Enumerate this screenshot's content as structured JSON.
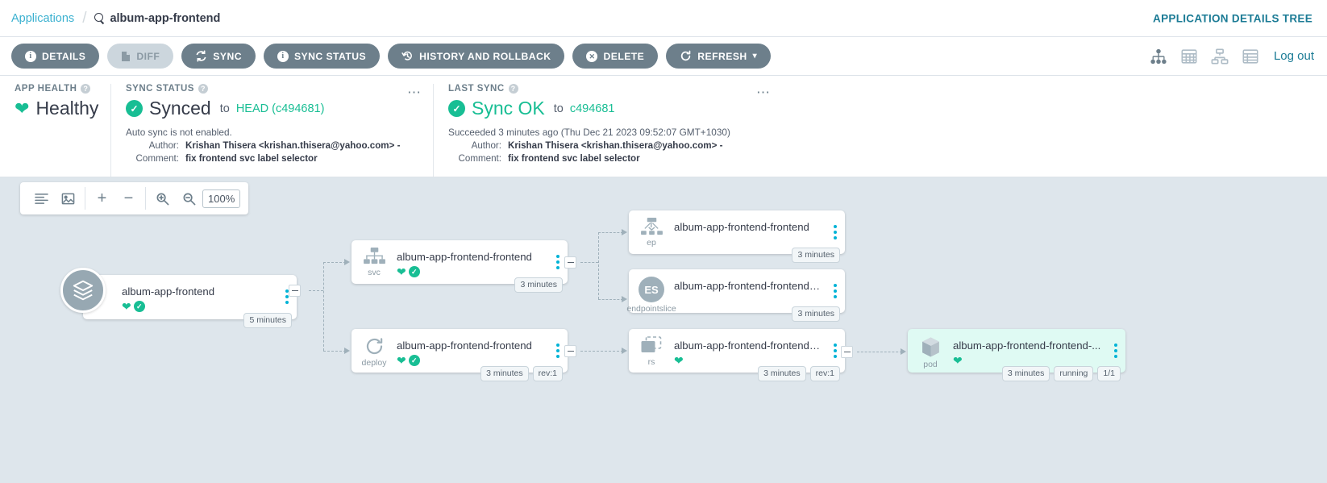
{
  "breadcrumb": {
    "root_label": "Applications",
    "separator": "/",
    "current_label": "album-app-frontend",
    "search_icon": "search-icon"
  },
  "header": {
    "details_tree_label": "APPLICATION DETAILS TREE",
    "logout_label": "Log out"
  },
  "toolbar": {
    "buttons": [
      {
        "label": "DETAILS",
        "icon": "info-icon",
        "disabled": false
      },
      {
        "label": "DIFF",
        "icon": "file-icon",
        "disabled": true
      },
      {
        "label": "SYNC",
        "icon": "sync-icon",
        "disabled": false
      },
      {
        "label": "SYNC STATUS",
        "icon": "info-icon",
        "disabled": false
      },
      {
        "label": "HISTORY AND ROLLBACK",
        "icon": "history-icon",
        "disabled": false
      },
      {
        "label": "DELETE",
        "icon": "delete-icon",
        "disabled": false
      },
      {
        "label": "REFRESH",
        "icon": "refresh-icon",
        "disabled": false,
        "caret": "▾"
      }
    ],
    "view_icons": [
      "tree-view-icon",
      "grid-view-icon",
      "network-view-icon",
      "list-view-icon"
    ]
  },
  "panels": {
    "health": {
      "title": "APP HEALTH",
      "help_icon": "help-icon",
      "status": "Healthy",
      "icon": "heart-icon"
    },
    "sync": {
      "title": "SYNC STATUS",
      "help_icon": "help-icon",
      "status": "Synced",
      "to_word": "to",
      "revision": "HEAD (c494681)",
      "note": "Auto sync is not enabled.",
      "author_key": "Author:",
      "author_value": "Krishan Thisera <krishan.thisera@yahoo.com> -",
      "comment_key": "Comment:",
      "comment_value": "fix frontend svc label selector",
      "overflow_icon": "more-options-icon"
    },
    "last_sync": {
      "title": "LAST SYNC",
      "help_icon": "help-icon",
      "status": "Sync OK",
      "to_word": "to",
      "revision": "c494681",
      "note": "Succeeded 3 minutes ago (Thu Dec 21 2023 09:52:07 GMT+1030)",
      "author_key": "Author:",
      "author_value": "Krishan Thisera <krishan.thisera@yahoo.com> -",
      "comment_key": "Comment:",
      "comment_value": "fix frontend svc label selector",
      "overflow_icon": "more-options-icon"
    }
  },
  "graph_toolbar": {
    "compact_icon": "compact-view-icon",
    "fit_icon": "fit-to-screen-icon",
    "plus_label": "+",
    "minus_label": "−",
    "zoom_in_icon": "zoom-in-icon",
    "zoom_out_icon": "zoom-out-icon",
    "zoom_level": "100%"
  },
  "tree": {
    "nodes": [
      {
        "id": "app",
        "kind": "",
        "title": "album-app-frontend",
        "icon": "layers-icon",
        "health": "healthy",
        "synced": true,
        "badges": [
          "5 minutes"
        ],
        "highlight": false
      },
      {
        "id": "svc",
        "kind": "svc",
        "title": "album-app-frontend-frontend",
        "icon": "service-icon",
        "health": "healthy",
        "synced": true,
        "badges": [
          "3 minutes"
        ],
        "highlight": false
      },
      {
        "id": "deploy",
        "kind": "deploy",
        "title": "album-app-frontend-frontend",
        "icon": "deployment-icon",
        "health": "healthy",
        "synced": true,
        "badges": [
          "3 minutes",
          "rev:1"
        ],
        "highlight": false
      },
      {
        "id": "ep",
        "kind": "ep",
        "title": "album-app-frontend-frontend",
        "icon": "endpoints-icon",
        "health": "none",
        "synced": false,
        "badges": [
          "3 minutes"
        ],
        "highlight": false
      },
      {
        "id": "endpointslice",
        "kind": "endpointslice",
        "title": "album-app-frontend-frontend-...",
        "icon": "ES",
        "health": "none",
        "synced": false,
        "badges": [
          "3 minutes"
        ],
        "highlight": false
      },
      {
        "id": "rs",
        "kind": "rs",
        "title": "album-app-frontend-frontend-...",
        "icon": "replicaset-icon",
        "health": "healthy",
        "synced": false,
        "badges": [
          "3 minutes",
          "rev:1"
        ],
        "highlight": false
      },
      {
        "id": "pod",
        "kind": "pod",
        "title": "album-app-frontend-frontend-...",
        "icon": "pod-icon",
        "health": "healthy",
        "synced": false,
        "badges": [
          "3 minutes",
          "running",
          "1/1"
        ],
        "highlight": true
      }
    ]
  }
}
